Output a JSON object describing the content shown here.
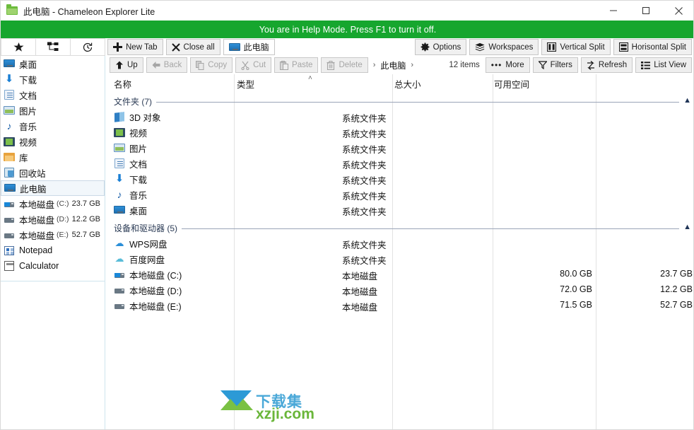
{
  "window": {
    "title": "此电脑 - Chameleon Explorer Lite",
    "title_icon": "folder-icon",
    "minimize": "–",
    "maximize": "□",
    "close": "✕"
  },
  "help_bar": {
    "message": "You are in Help Mode. Press F1 to turn it off.",
    "color": "#16a62e"
  },
  "toolbar_top": {
    "icon_buttons": [
      {
        "name": "favorites-icon",
        "glyph": "★"
      },
      {
        "name": "tree-view-icon",
        "glyph": "tree"
      },
      {
        "name": "history-icon",
        "glyph": "clock"
      }
    ],
    "new_tab": "New Tab",
    "close_all": "Close all",
    "active_tab": "此电脑",
    "options": "Options",
    "workspaces": "Workspaces",
    "vertical_split": "Vertical Split",
    "horisontal_split": "Horisontal Split"
  },
  "toolbar_nav": {
    "up": "Up",
    "back": "Back",
    "copy": "Copy",
    "cut": "Cut",
    "paste": "Paste",
    "delete": "Delete",
    "breadcrumb": "此电脑",
    "item_count": "12 items",
    "more": "More",
    "filters": "Filters",
    "refresh": "Refresh",
    "list_view": "List View"
  },
  "sidebar": {
    "items": [
      {
        "label": "桌面",
        "icon": "monitor-icon",
        "sub": "",
        "size": "",
        "selected": false
      },
      {
        "label": "下载",
        "icon": "download-icon",
        "sub": "",
        "size": "",
        "selected": false
      },
      {
        "label": "文档",
        "icon": "document-icon",
        "sub": "",
        "size": "",
        "selected": false
      },
      {
        "label": "图片",
        "icon": "picture-icon",
        "sub": "",
        "size": "",
        "selected": false
      },
      {
        "label": "音乐",
        "icon": "music-icon",
        "sub": "",
        "size": "",
        "selected": false
      },
      {
        "label": "视频",
        "icon": "video-icon",
        "sub": "",
        "size": "",
        "selected": false
      },
      {
        "label": "库",
        "icon": "library-icon",
        "sub": "",
        "size": "",
        "selected": false
      },
      {
        "label": "回收站",
        "icon": "recycle-bin-icon",
        "sub": "",
        "size": "",
        "selected": false
      },
      {
        "label": "此电脑",
        "icon": "computer-icon",
        "sub": "",
        "size": "",
        "selected": true
      },
      {
        "label": "本地磁盘",
        "icon": "drive-c-icon",
        "sub": "(C:)",
        "size": "23.7 GB",
        "selected": false
      },
      {
        "label": "本地磁盘",
        "icon": "drive-icon",
        "sub": "(D:)",
        "size": "12.2 GB",
        "selected": false
      },
      {
        "label": "本地磁盘",
        "icon": "drive-icon",
        "sub": "(E:)",
        "size": "52.7 GB",
        "selected": false
      },
      {
        "label": "Notepad",
        "icon": "notepad-icon",
        "sub": "",
        "size": "",
        "selected": false
      },
      {
        "label": "Calculator",
        "icon": "calculator-icon",
        "sub": "",
        "size": "",
        "selected": false
      }
    ]
  },
  "file_pane": {
    "columns": [
      {
        "key": "name",
        "label": "名称"
      },
      {
        "key": "type",
        "label": "类型"
      },
      {
        "key": "size",
        "label": "总大小"
      },
      {
        "key": "free",
        "label": "可用空间"
      }
    ],
    "sort_indicator": "˄",
    "groups": [
      {
        "title": "文件夹 (7)",
        "collapse_icon": "▲",
        "rows": [
          {
            "name": "3D 对象",
            "icon": "3d-objects-icon",
            "type": "系统文件夹",
            "size": "",
            "free": ""
          },
          {
            "name": "视频",
            "icon": "video-icon",
            "type": "系统文件夹",
            "size": "",
            "free": ""
          },
          {
            "name": "图片",
            "icon": "picture-icon",
            "type": "系统文件夹",
            "size": "",
            "free": ""
          },
          {
            "name": "文档",
            "icon": "document-icon",
            "type": "系统文件夹",
            "size": "",
            "free": ""
          },
          {
            "name": "下载",
            "icon": "download-icon",
            "type": "系统文件夹",
            "size": "",
            "free": ""
          },
          {
            "name": "音乐",
            "icon": "music-icon",
            "type": "系统文件夹",
            "size": "",
            "free": ""
          },
          {
            "name": "桌面",
            "icon": "monitor-icon",
            "type": "系统文件夹",
            "size": "",
            "free": ""
          }
        ]
      },
      {
        "title": "设备和驱动器 (5)",
        "collapse_icon": "▲",
        "rows": [
          {
            "name": "WPS网盘",
            "icon": "wps-cloud-icon",
            "type": "系统文件夹",
            "size": "",
            "free": ""
          },
          {
            "name": "百度网盘",
            "icon": "baidu-cloud-icon",
            "type": "系统文件夹",
            "size": "",
            "free": ""
          },
          {
            "name": "本地磁盘 (C:)",
            "icon": "drive-c-icon",
            "type": "本地磁盘",
            "size": "80.0 GB",
            "free": "23.7 GB"
          },
          {
            "name": "本地磁盘 (D:)",
            "icon": "drive-icon",
            "type": "本地磁盘",
            "size": "72.0 GB",
            "free": "12.2 GB"
          },
          {
            "name": "本地磁盘 (E:)",
            "icon": "drive-icon",
            "type": "本地磁盘",
            "size": "71.5 GB",
            "free": "52.7 GB"
          }
        ]
      }
    ]
  },
  "watermark": {
    "cn": "下载集",
    "en": "xzji.com"
  }
}
